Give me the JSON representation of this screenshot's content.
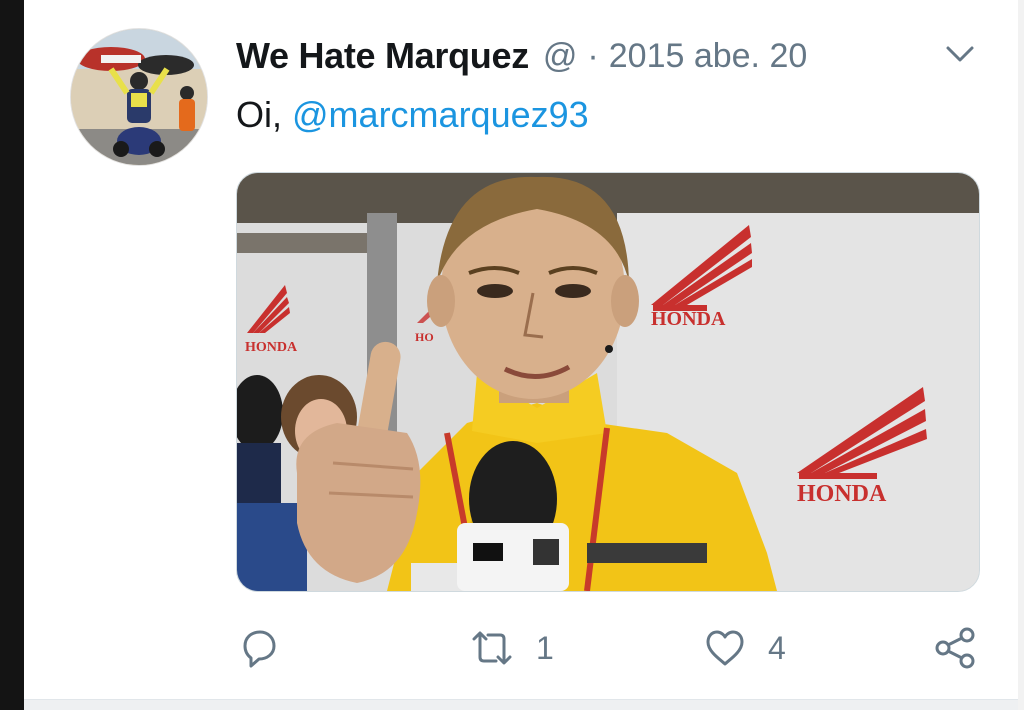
{
  "tweet": {
    "display_name": "We Hate Marquez",
    "handle": "@",
    "separator": "·",
    "date": "2015 abe. 20",
    "text_prefix": "Oi, ",
    "mention": "@marcmarquez93",
    "media": {
      "brand_text_1": "HONDA",
      "brand_text_2": "HONDA",
      "brand_text_3": "HONDA",
      "brand_text_4": "HO"
    }
  },
  "actions": {
    "reply_icon": "reply-icon",
    "retweet_icon": "retweet-icon",
    "retweet_count": "1",
    "like_icon": "heart-icon",
    "like_count": "4",
    "share_icon": "share-icon"
  },
  "colors": {
    "text": "#14171a",
    "secondary": "#657786",
    "link": "#1b95e0",
    "honda_red": "#c8302e",
    "jacket_yellow": "#f2c417"
  }
}
